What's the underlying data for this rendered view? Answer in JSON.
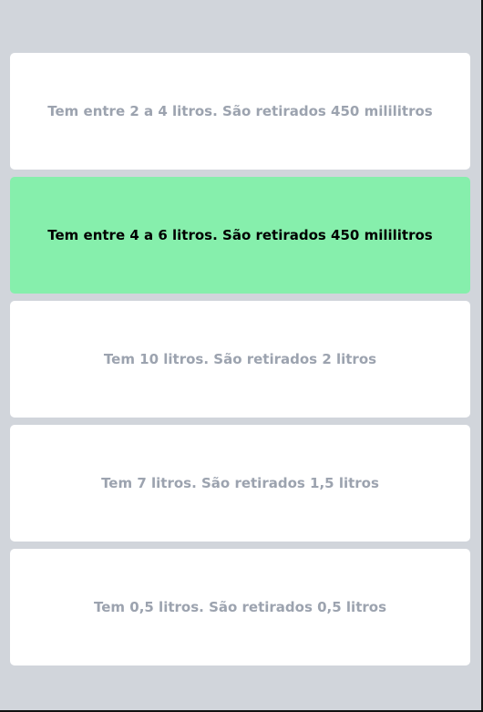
{
  "answer_options": [
    {
      "label": "Tem entre 2 a 4 litros. São retirados 450 mililitros",
      "selected": false
    },
    {
      "label": "Tem entre 4 a 6 litros. São retirados 450 mililitros",
      "selected": true
    },
    {
      "label": "Tem 10 litros. São retirados 2 litros",
      "selected": false
    },
    {
      "label": "Tem 7 litros. São retirados 1,5 litros",
      "selected": false
    },
    {
      "label": "Tem 0,5 litros. São retirados 0,5 litros",
      "selected": false
    }
  ],
  "colors": {
    "background": "#d1d5db",
    "option_background": "#ffffff",
    "selected_background": "#86efac",
    "option_text": "#9ca3af",
    "selected_text": "#000000"
  }
}
